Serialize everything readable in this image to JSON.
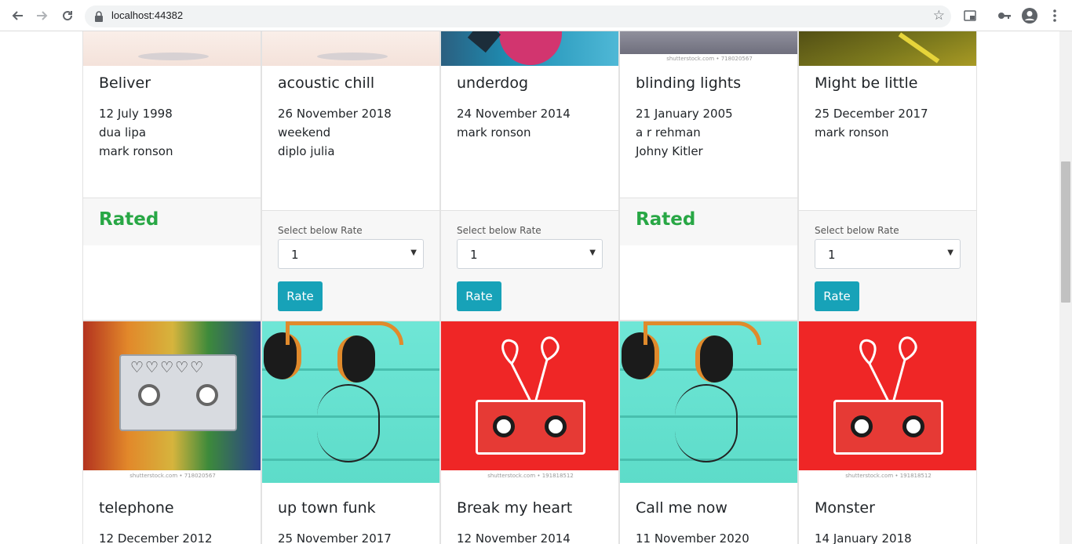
{
  "browser": {
    "url": "localhost:44382"
  },
  "cards_top": [
    {
      "title": "Beliver",
      "lines": [
        "12 July 1998",
        "dua lipa",
        "mark ronson"
      ],
      "status": "Rated"
    },
    {
      "title": "acoustic chill",
      "lines": [
        "26 November 2018",
        "weekend",
        "diplo julia"
      ],
      "status": "rate"
    },
    {
      "title": "underdog",
      "lines": [
        "24 November 2014",
        "mark ronson",
        ""
      ],
      "status": "rate"
    },
    {
      "title": "blinding lights",
      "lines": [
        "21 January 2005",
        "a r rehman",
        "Johny Kitler"
      ],
      "status": "Rated"
    },
    {
      "title": "Might be little",
      "lines": [
        "25 December 2017",
        "mark ronson",
        ""
      ],
      "status": "rate"
    }
  ],
  "cards_bottom": [
    {
      "title": "telephone",
      "line1": "12 December 2012",
      "image": "cassette-hearts"
    },
    {
      "title": "up town funk",
      "line1": "25 November 2017",
      "image": "headphones-teal"
    },
    {
      "title": "Break my heart",
      "line1": "12 November 2014",
      "image": "cassette-red"
    },
    {
      "title": "Call me now",
      "line1": "11 November 2020",
      "image": "headphones-teal"
    },
    {
      "title": "Monster",
      "line1": "14 January 2018",
      "image": "cassette-red"
    }
  ],
  "rating": {
    "label": "Select below Rate",
    "selected": "1",
    "button": "Rate",
    "rated_text": "Rated"
  },
  "watermarks": {
    "a": "shutterstock.com • 718020567",
    "b": "shutterstock.com • 191818512"
  },
  "colors": {
    "rated": "#28a745",
    "button": "#17a2b8"
  }
}
